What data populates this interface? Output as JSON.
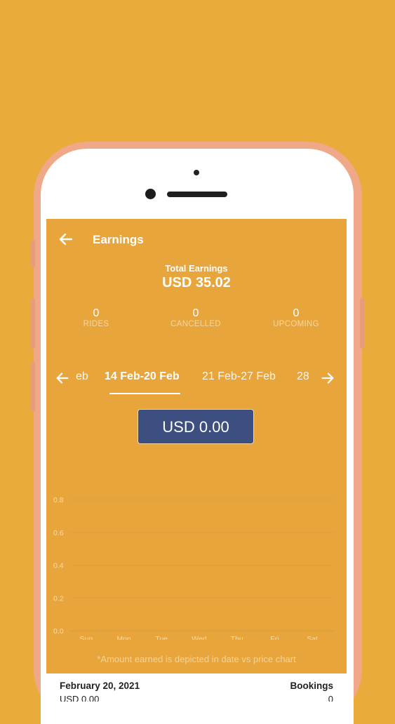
{
  "header": {
    "title": "Earnings"
  },
  "summary": {
    "total_label": "Total Earnings",
    "total_value": "USD 35.02"
  },
  "stats": [
    {
      "value": "0",
      "label": "RIDES"
    },
    {
      "value": "0",
      "label": "CANCELLED"
    },
    {
      "value": "0",
      "label": "UPCOMING"
    }
  ],
  "weeks": {
    "prev_partial": "eb",
    "active": "14 Feb-20 Feb",
    "next": "21 Feb-27 Feb",
    "next_partial": "28"
  },
  "amount_button": "USD 0.00",
  "chart_data": {
    "type": "bar",
    "categories": [
      "Sun",
      "Mon",
      "Tue",
      "Wed",
      "Thu",
      "Fri",
      "Sat"
    ],
    "values": [
      0,
      0,
      0,
      0,
      0,
      0,
      0
    ],
    "ylim": [
      0,
      0.8
    ],
    "yticks": [
      "0.0",
      "0.2",
      "0.4",
      "0.6",
      "0.8"
    ],
    "grid": true
  },
  "chart_note": "*Amount earned is depicted in date vs price chart",
  "detail": {
    "date": "February 20, 2021",
    "bookings_label": "Bookings",
    "amount": "USD 0.00",
    "count": "0"
  },
  "colors": {
    "background": "#e9ab3a",
    "screen": "#e8a53c",
    "button": "#3c4f80",
    "phone": "#f0a988"
  }
}
